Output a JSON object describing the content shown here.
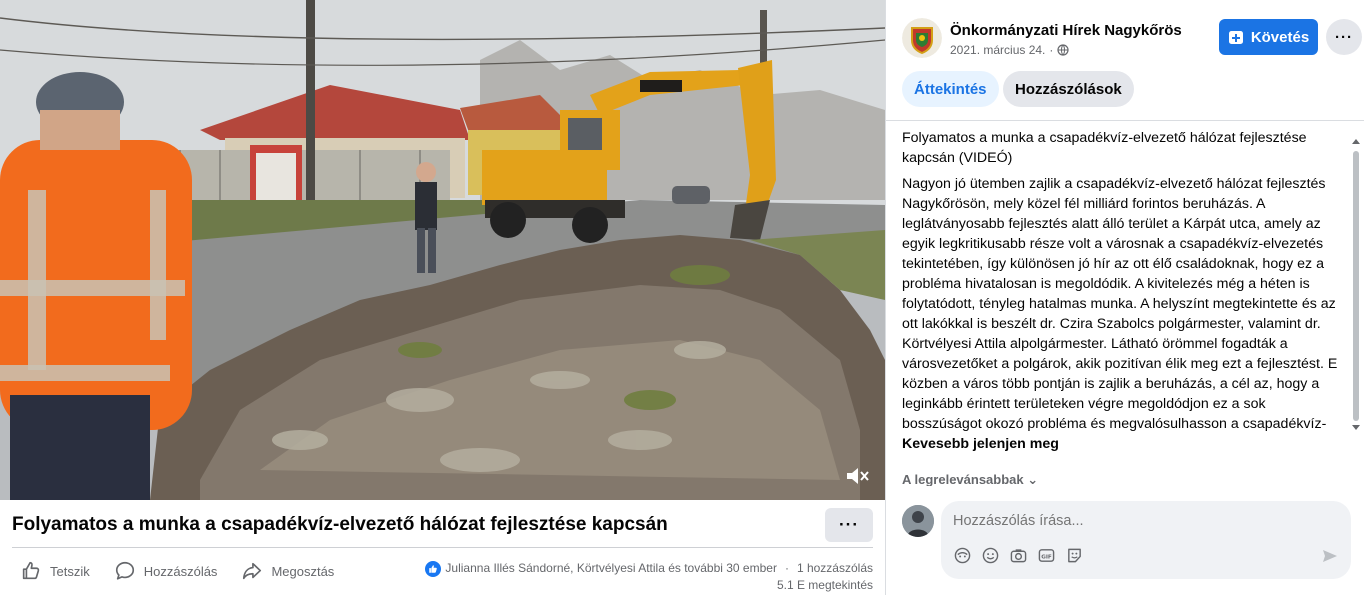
{
  "video": {
    "icons": {
      "mute": "speaker-muted-icon"
    }
  },
  "post": {
    "title": "Folyamatos a munka a csapadékvíz-elvezető hálózat fejlesztése kapcsán",
    "more": "···",
    "actions": {
      "like": "Tetszik",
      "comment": "Hozzászólás",
      "share": "Megosztás"
    },
    "reactions": {
      "names": "Julianna Illés Sándorné, Körtvélyesi Attila és további 30 ember",
      "comments": "1 hozzászólás",
      "views": "5.1 E megtekintés"
    }
  },
  "panel": {
    "page_name": "Önkormányzati Hírek Nagykőrös",
    "date": "2021. március 24.",
    "date_separator": "·",
    "follow_label": "Követés",
    "more": "···",
    "tabs": [
      {
        "label": "Áttekintés",
        "active": true
      },
      {
        "label": "Hozzászólások",
        "active": false
      }
    ],
    "description": {
      "headline": "Folyamatos a munka a csapadékvíz-elvezető hálózat fejlesztése kapcsán (VIDEÓ)",
      "body": "Nagyon jó ütemben zajlik a csapadékvíz-elvezető hálózat fejlesztés Nagykőrösön, mely közel fél milliárd forintos beruházás. A leglátványosabb fejlesztés alatt álló terület a Kárpát utca, amely az egyik legkritikusabb része volt a városnak a csapadékvíz-elvezetés tekintetében, így különösen jó hír az ott élő családoknak, hogy ez a probléma hivatalosan is megoldódik. A kivitelezés még a héten is folytatódott, tényleg hatalmas munka. A helyszínt megtekintette és az ott lakókkal is beszélt dr. Czira Szabolcs polgármester, valamint dr. Körtvélyesi Attila alpolgármester. Látható örömmel fogadták a városvezetőket a polgárok, akik pozitívan élik meg ezt a fejlesztést. E közben a város több pontján is zajlik a beruházás, a cél az, hogy a leginkább érintett területeken végre megoldódjon ez a sok bosszúságot okozó probléma és megvalósulhasson a csapadékvíz-",
      "show_less": "Kevesebb jelenjen meg"
    },
    "relevance_label": "A legrelevánsabbak",
    "comment": {
      "placeholder": "Hozzászólás írása...",
      "tools": [
        "avatar-sticker-icon",
        "emoji-icon",
        "camera-icon",
        "gif-icon",
        "sticker-icon"
      ],
      "send_icon": "send-icon"
    }
  },
  "colors": {
    "accent": "#1b74e4",
    "tab_active_bg": "#e7f3ff",
    "secondary_text": "#65676b",
    "button_gray": "#e4e6eb",
    "safety_orange": "#f26b1d",
    "excavator_yellow": "#e3a21a"
  }
}
